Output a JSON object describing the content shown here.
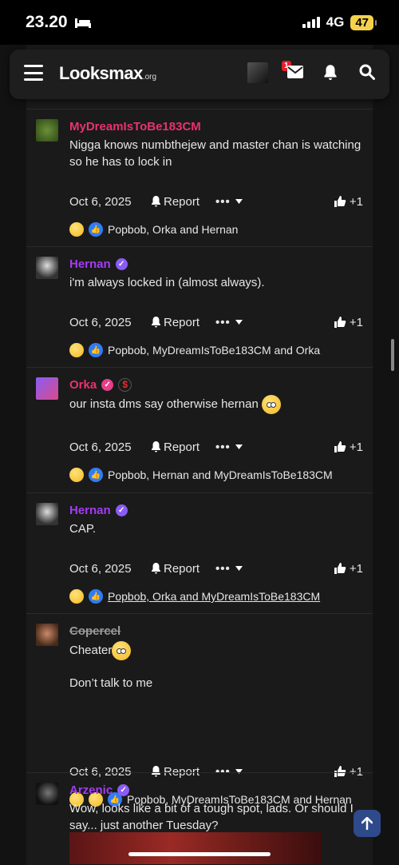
{
  "status_bar": {
    "time": "23.20",
    "network": "4G",
    "battery": "47"
  },
  "header": {
    "logo_main": "Looksmax",
    "logo_suffix": ".org",
    "notification_count": "1"
  },
  "posts": [
    {
      "username": "MyDreamIsToBe183CM",
      "name_color": "#e8336d",
      "message": "Nigga knows numbthejew and master chan is watching so he has to lock in",
      "date": "Oct 6, 2025",
      "report": "Report",
      "more": "•••",
      "like": "+1",
      "reactions": "Popbob, Orka and Hernan"
    },
    {
      "username": "Hernan",
      "name_color": "#a23cf2",
      "message": "i'm always locked in (almost always).",
      "date": "Oct 6, 2025",
      "report": "Report",
      "more": "•••",
      "like": "+1",
      "reactions": "Popbob, MyDreamIsToBe183CM and Orka"
    },
    {
      "username": "Orka",
      "name_color": "#e8336d",
      "message": "our insta dms say otherwise hernan",
      "date": "Oct 6, 2025",
      "report": "Report",
      "more": "•••",
      "like": "+1",
      "reactions": "Popbob, Hernan and MyDreamIsToBe183CM"
    },
    {
      "username": "Hernan",
      "name_color": "#a23cf2",
      "message": "CAP.",
      "date": "Oct 6, 2025",
      "report": "Report",
      "more": "•••",
      "like": "+1",
      "reactions": "Popbob, Orka and MyDreamIsToBe183CM"
    },
    {
      "username": "Copercel",
      "name_color": "#9a9a9a",
      "message": "Cheater",
      "message2": "Don’t talk to me",
      "date": "Oct 6, 2025",
      "report": "Report",
      "more": "•••",
      "like": "+1",
      "reactions": "Popbob, MyDreamIsToBe183CM and Hernan"
    },
    {
      "username": "Arzenic",
      "name_color": "#a23cf2",
      "message": "Wow, looks like a bit of a tough spot, lads. Or should I say... just another Tuesday?"
    }
  ]
}
